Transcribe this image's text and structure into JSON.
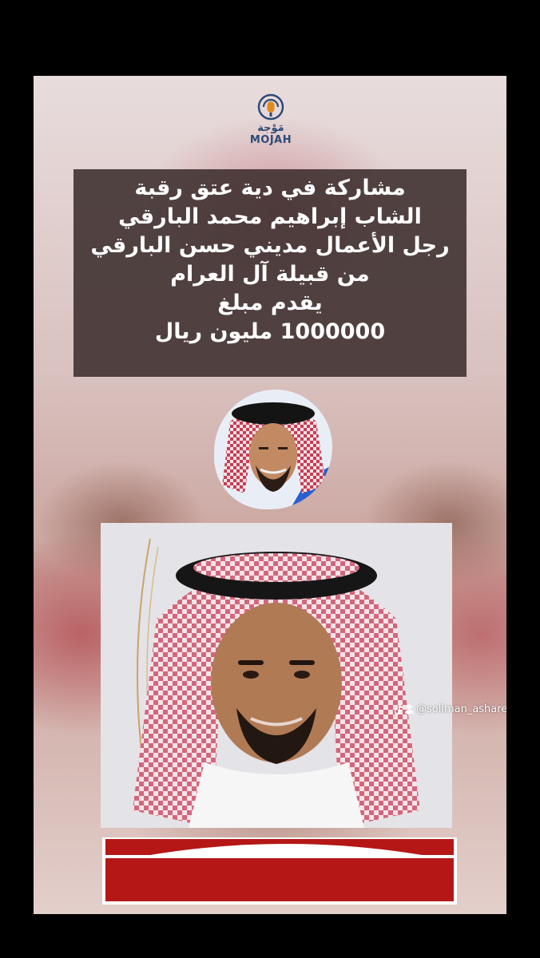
{
  "logo": {
    "arabic": "مَوْجة",
    "english": "MOJAH",
    "icon": "microphone-icon",
    "color": "#2c4a78",
    "accent": "#e08a1e"
  },
  "announcement": {
    "lines": [
      "مشاركة في دية عتق رقبة",
      "الشاب إبراهيم محمد البارقي",
      "رجل الأعمال مديني حسن البارقي",
      "من قبيلة آل العرام",
      "يقدم مبلغ",
      "1000000 مليون ريال"
    ]
  },
  "watermark": {
    "icons": [
      "tiktok-icon",
      "user-icon"
    ],
    "handle": "@soliman_asharef"
  },
  "banner": {
    "color": "#b51717"
  }
}
